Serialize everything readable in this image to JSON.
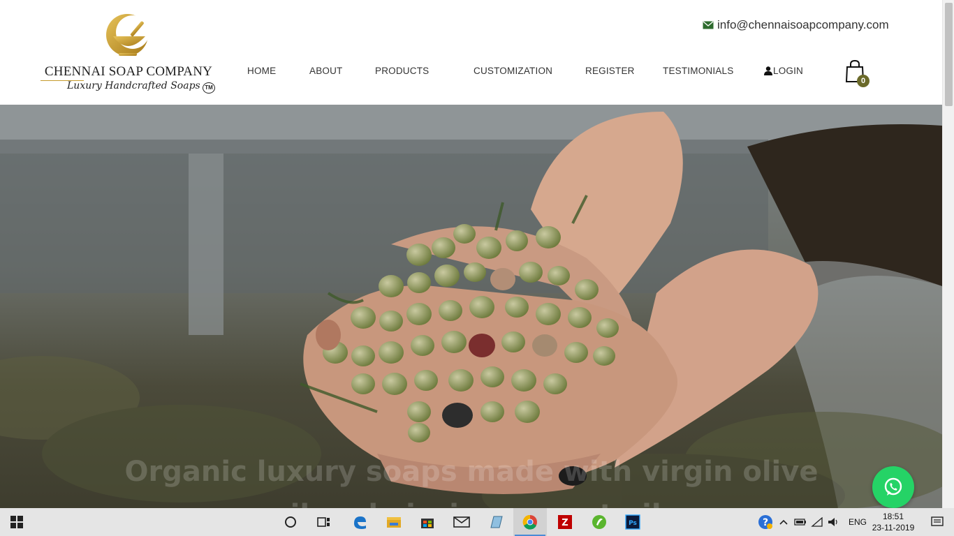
{
  "header": {
    "logo": {
      "brand": "CHENNAI SOAP COMPANY",
      "tagline": "Luxury Handcrafted Soaps",
      "trademark": "TM"
    },
    "email": "info@chennaisoapcompany.com",
    "nav": [
      {
        "label": "HOME"
      },
      {
        "label": "ABOUT"
      },
      {
        "label": "PRODUCTS"
      },
      {
        "label": "CUSTOMIZATION"
      },
      {
        "label": "REGISTER"
      },
      {
        "label": "TESTIMONIALS"
      },
      {
        "label": "LOGIN"
      }
    ],
    "cart_count": "0"
  },
  "hero": {
    "caption_line1": "Organic luxury soaps made with virgin olive",
    "caption_line2": "oil and virgin coconut oil."
  },
  "taskbar": {
    "language": "ENG",
    "time": "18:51",
    "date": "23-11-2019",
    "apps": [
      "search-icon",
      "task-view-icon",
      "edge-icon",
      "file-explorer-icon",
      "store-icon",
      "mail-icon",
      "notes-icon",
      "chrome-icon",
      "filezilla-icon",
      "dreamweaver-icon",
      "photoshop-icon"
    ]
  },
  "colors": {
    "gold": "#c59a2c",
    "nav_text": "#333333",
    "cart_badge": "#6b6a2a",
    "whatsapp": "#25d366"
  }
}
